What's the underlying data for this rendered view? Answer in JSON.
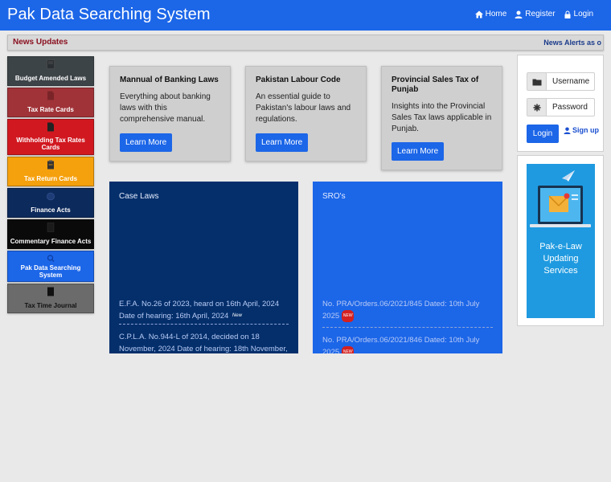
{
  "header": {
    "title": "Pak Data Searching System",
    "nav": [
      {
        "icon": "home-icon",
        "label": "Home"
      },
      {
        "icon": "user-icon",
        "label": "Register"
      },
      {
        "icon": "lock-icon",
        "label": "Login"
      }
    ]
  },
  "news": {
    "label": "News Updates",
    "ticker": "News Alerts as o"
  },
  "sidebar": {
    "items": [
      {
        "label": "Budget Amended Laws",
        "color": "#3d4448"
      },
      {
        "label": "Tax Rate Cards",
        "color": "#a03338"
      },
      {
        "label": "Withholding Tax Rates Cards",
        "color": "#d11820"
      },
      {
        "label": "Tax Return Cards",
        "color": "#f5a00d"
      },
      {
        "label": "Finance Acts",
        "color": "#0d2a5c"
      },
      {
        "label": "Commentary Finance Acts",
        "color": "#0a0a0a"
      },
      {
        "label": "Pak Data Searching System",
        "color": "#1c66e8"
      },
      {
        "label": "Tax Time Journal",
        "color": "#5a5a5a"
      }
    ]
  },
  "cards": [
    {
      "title": "Mannual of Banking Laws",
      "text": "Everything about banking laws with this comprehensive manual.",
      "button": "Learn More"
    },
    {
      "title": "Pakistan Labour Code",
      "text": "An essential guide to Pakistan's labour laws and regulations.",
      "button": "Learn More"
    },
    {
      "title": "Provincial Sales Tax of Punjab",
      "text": "Insights into the Provincial Sales Tax laws applicable in Punjab.",
      "button": "Learn More"
    }
  ],
  "panels": {
    "case_laws": {
      "title": "Case Laws",
      "entries": [
        "E.F.A. No.26 of 2023, heard on 16th April, 2024 Date of hearing: 16th April, 2024",
        "C.P.L.A. No.944-L of 2014, decided on 18 November, 2024 Date of hearing: 18th November,"
      ],
      "badge": "New"
    },
    "sros": {
      "title": "SRO's",
      "entries": [
        "No. PRA/Orders.06/2021/845 Dated: 10th July 2025",
        "No. PRA/Orders.06/2021/846 Dated: 10th July 2025"
      ],
      "badge": "NEW"
    }
  },
  "login": {
    "username_placeholder": "Username",
    "password_placeholder": "Password",
    "login_button": "Login",
    "signup_label": "Sign up"
  },
  "promo": {
    "line1": "Pak-e-Law",
    "line2": "Updating",
    "line3": "Services"
  }
}
